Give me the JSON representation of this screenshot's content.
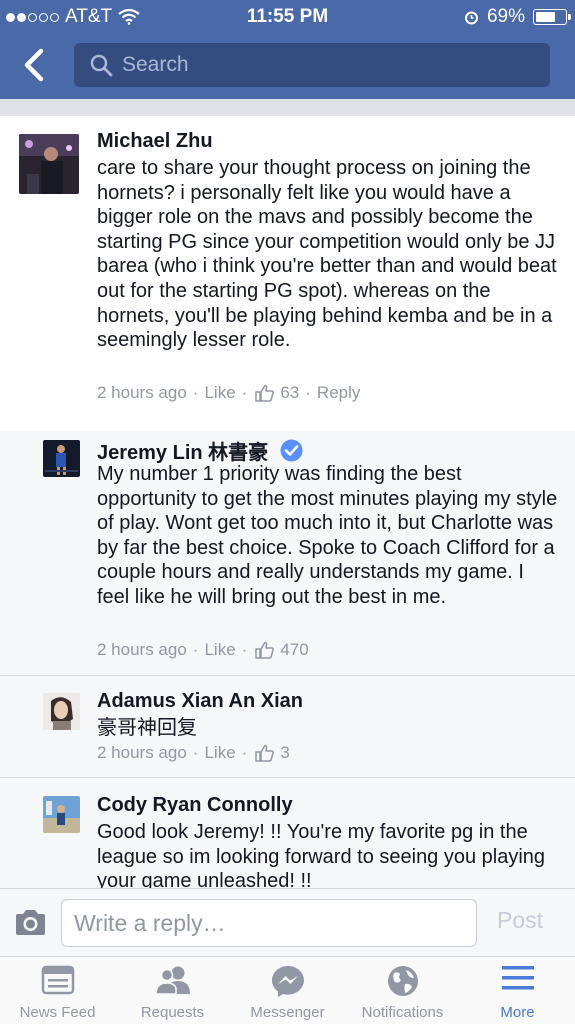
{
  "status_bar": {
    "carrier": "AT&T",
    "time": "11:55 PM",
    "battery": "69%",
    "battery_level": 0.69
  },
  "nav": {
    "search_placeholder": "Search"
  },
  "comments": [
    {
      "name": "Michael Zhu",
      "text": "care to share your thought process on joining the hornets? i personally felt like you would have a bigger role on the mavs and possibly become the starting PG since your competition would only be JJ barea (who i think you're better than and would beat out for the starting PG spot). whereas on the hornets, you'll be playing behind kemba and be in a seemingly lesser role.",
      "time": "2 hours ago",
      "like_label": "Like",
      "likes": "63",
      "reply_label": "Reply"
    },
    {
      "name": "Jeremy Lin 林書豪",
      "text": "My number 1 priority was finding the best opportunity to get the most minutes playing my style of play. Wont get too much into it, but Charlotte was by far the best choice. Spoke to Coach Clifford for a couple hours and really understands my game. I feel like he will bring out the best in me.",
      "time": "2 hours ago",
      "like_label": "Like",
      "likes": "470"
    },
    {
      "name": "Adamus Xian An Xian",
      "text": "豪哥神回复",
      "time": "2 hours ago",
      "like_label": "Like",
      "likes": "3"
    },
    {
      "name": "Cody Ryan Connolly",
      "text": "Good look Jeremy! !! You're my favorite pg in the league so im looking forward to seeing you playing your game unleashed! !!"
    }
  ],
  "composer": {
    "placeholder": "Write a reply…",
    "post_label": "Post"
  },
  "tabs": [
    {
      "label": "News Feed",
      "icon": "news-feed-icon"
    },
    {
      "label": "Requests",
      "icon": "friend-requests-icon"
    },
    {
      "label": "Messenger",
      "icon": "messenger-icon"
    },
    {
      "label": "Notifications",
      "icon": "globe-icon"
    },
    {
      "label": "More",
      "icon": "menu-icon",
      "active": true
    }
  ],
  "colors": {
    "brand": "#4a69a8",
    "link_active": "#4a7bd6",
    "meta_gray": "#9197a3",
    "verified": "#5890ff"
  }
}
